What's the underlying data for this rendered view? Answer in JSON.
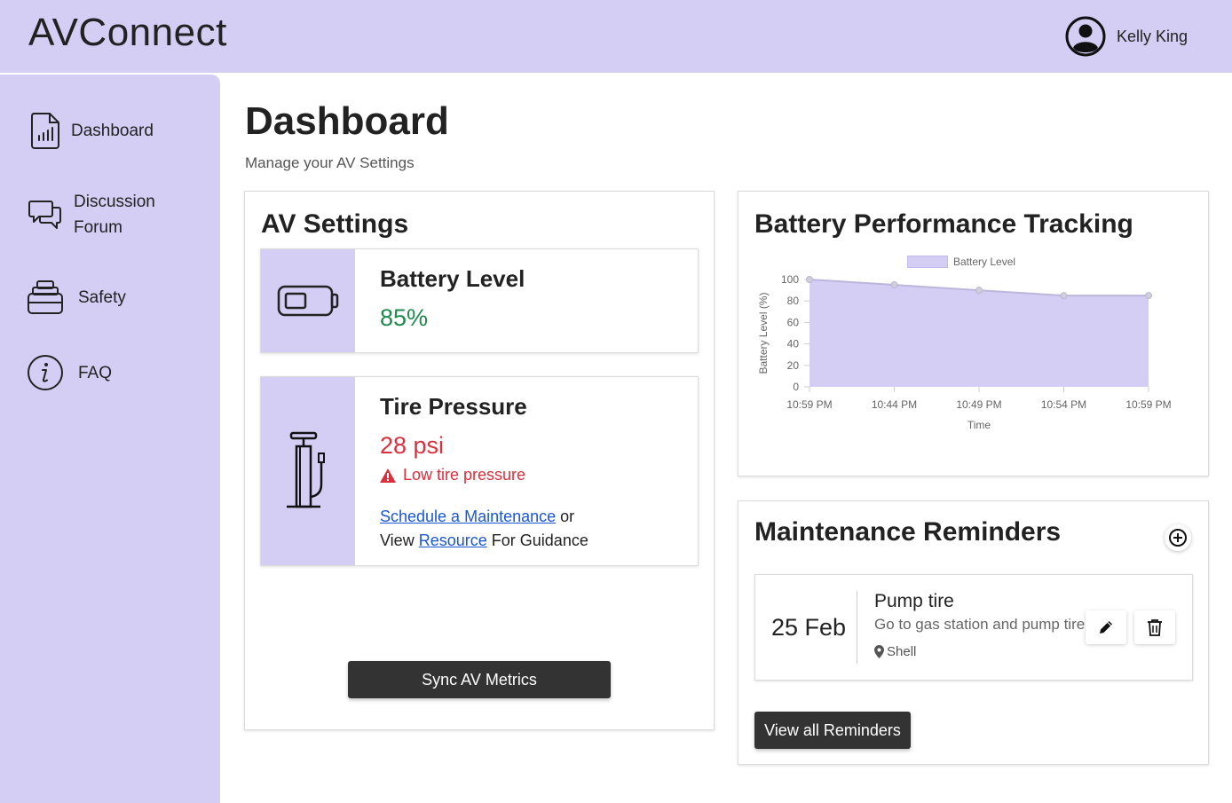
{
  "header": {
    "brand": "AVConnect",
    "user_name": "Kelly King"
  },
  "sidebar": {
    "items": [
      {
        "label": "Dashboard",
        "icon": "chart-document-icon"
      },
      {
        "label_line1": "Discussion",
        "label_line2": "Forum",
        "icon": "chat-bubbles-icon"
      },
      {
        "label": "Safety",
        "icon": "stacked-box-icon"
      },
      {
        "label": "FAQ",
        "icon": "info-circle-icon"
      }
    ]
  },
  "page": {
    "title": "Dashboard",
    "subtitle": "Manage your AV Settings"
  },
  "av_settings": {
    "title": "AV Settings",
    "battery": {
      "label": "Battery Level",
      "value": "85%"
    },
    "tire": {
      "label": "Tire Pressure",
      "value": "28 psi",
      "warning": "Low tire pressure",
      "schedule_link": "Schedule a Maintenance",
      "or_text": "or",
      "view_text": "View",
      "resource_link": "Resource",
      "guidance_text": "For Guidance"
    },
    "sync_button": "Sync AV Metrics"
  },
  "battery_chart": {
    "title": "Battery Performance Tracking"
  },
  "chart_data": {
    "type": "area",
    "categories": [
      "10:59 PM",
      "10:44 PM",
      "10:49 PM",
      "10:54 PM",
      "10:59 PM"
    ],
    "series": [
      {
        "name": "Battery Level",
        "values": [
          100,
          95,
          90,
          85,
          85
        ]
      }
    ],
    "xlabel": "Time",
    "ylabel": "Battery Level (%)",
    "ylim": [
      0,
      100
    ],
    "yticks": [
      "0",
      "20",
      "40",
      "60",
      "80",
      "100"
    ],
    "legend": "top",
    "fill_color": "#d4cdf4"
  },
  "maintenance": {
    "title": "Maintenance Reminders",
    "reminders": [
      {
        "date": "25 Feb",
        "title": "Pump tire",
        "description": "Go to gas station and pump tire",
        "location": "Shell"
      }
    ],
    "view_all_button": "View all Reminders"
  },
  "colors": {
    "accent": "#d4cdf4",
    "good": "#1e8a4c",
    "bad": "#d9303e",
    "link": "#1a56d6",
    "dark_button": "#333333"
  }
}
